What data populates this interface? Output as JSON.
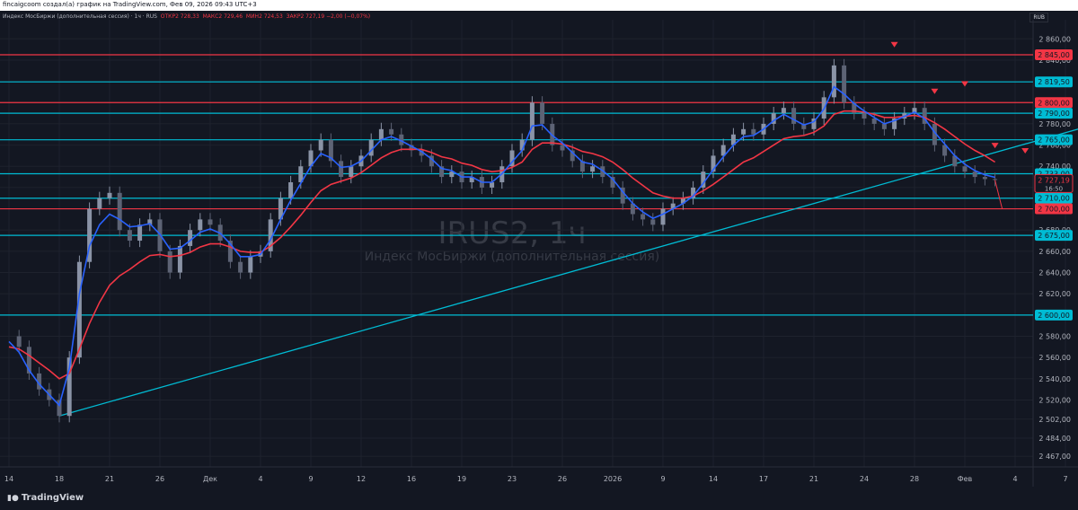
{
  "header": {
    "text": "fincaigcoom создал(а) график на TradingView.com, Фев 09, 2026 09:43 UTC+3",
    "legend": {
      "symbol": "Индекс МосБиржи (дополнительная сессия) · 1ч · RUS",
      "open": "ОТКР2 728,33",
      "high": "МАКС2 729,46",
      "low": "МИН2 724,53",
      "close": "ЗАКР2 727,19 −2,00 (−0,07%)"
    },
    "currency": "RUB"
  },
  "watermark": {
    "title": "IRUS2, 1ч",
    "subtitle": "Индекс МосБиржи (дополнительная сессия)"
  },
  "brand": {
    "name": "TradingView",
    "icon": "tradingview-logo-icon"
  },
  "colors": {
    "background": "#131722",
    "grid": "#1e222d",
    "cyan": "#00bcd4",
    "red_level": "#f23645",
    "ma_blue": "#2962ff",
    "ma_red": "#f23645",
    "candle_up": "#8a93a6",
    "candle_down": "#5d6375",
    "arrow": "#f23645"
  },
  "chart_data": {
    "type": "line",
    "title": "IRUS2, 1ч",
    "xlabel": "",
    "ylabel": "",
    "ylim": [
      2457,
      2878
    ],
    "grid": true,
    "x_ticks": [
      {
        "label": "14",
        "i": 0
      },
      {
        "label": "18",
        "i": 5
      },
      {
        "label": "21",
        "i": 10
      },
      {
        "label": "26",
        "i": 15
      },
      {
        "label": "Дек",
        "i": 20
      },
      {
        "label": "4",
        "i": 25
      },
      {
        "label": "9",
        "i": 30
      },
      {
        "label": "12",
        "i": 35
      },
      {
        "label": "16",
        "i": 40
      },
      {
        "label": "19",
        "i": 45
      },
      {
        "label": "23",
        "i": 50
      },
      {
        "label": "26",
        "i": 55
      },
      {
        "label": "2026",
        "i": 60
      },
      {
        "label": "9",
        "i": 65
      },
      {
        "label": "14",
        "i": 70
      },
      {
        "label": "17",
        "i": 75
      },
      {
        "label": "21",
        "i": 80
      },
      {
        "label": "24",
        "i": 85
      },
      {
        "label": "28",
        "i": 90
      },
      {
        "label": "Фев",
        "i": 95
      },
      {
        "label": "4",
        "i": 100
      },
      {
        "label": "7",
        "i": 105
      }
    ],
    "y_ticks": [
      "2 860,00",
      "2 840,00",
      "2 820,00",
      "2 800,00",
      "2 780,00",
      "2 760,00",
      "2 740,00",
      "2 720,00",
      "2 700,00",
      "2 680,00",
      "2 660,00",
      "2 640,00",
      "2 620,00",
      "2 600,00",
      "2 580,00",
      "2 560,00",
      "2 540,00",
      "2 520,00",
      "2 502,00",
      "2 484,00",
      "2 467,00"
    ],
    "series": [
      {
        "name": "",
        "kind": "close",
        "values": [
          2580,
          2570,
          2545,
          2530,
          2520,
          2505,
          2560,
          2650,
          2700,
          2710,
          2715,
          2680,
          2670,
          2685,
          2690,
          2660,
          2640,
          2665,
          2680,
          2690,
          2685,
          2670,
          2650,
          2640,
          2655,
          2660,
          2690,
          2710,
          2725,
          2740,
          2755,
          2765,
          2745,
          2730,
          2740,
          2750,
          2765,
          2775,
          2770,
          2760,
          2755,
          2750,
          2740,
          2730,
          2735,
          2725,
          2730,
          2720,
          2725,
          2740,
          2755,
          2765,
          2800,
          2780,
          2760,
          2755,
          2745,
          2735,
          2740,
          2730,
          2720,
          2705,
          2695,
          2690,
          2685,
          2700,
          2705,
          2710,
          2720,
          2735,
          2750,
          2760,
          2770,
          2775,
          2770,
          2780,
          2790,
          2795,
          2780,
          2775,
          2785,
          2805,
          2835,
          2800,
          2790,
          2785,
          2780,
          2775,
          2785,
          2790,
          2795,
          2780,
          2760,
          2750,
          2740,
          2735,
          2730,
          2728,
          2727.19
        ]
      },
      {
        "name": "",
        "kind": "ma_fast",
        "values": [
          2575,
          2565,
          2548,
          2535,
          2525,
          2515,
          2550,
          2620,
          2665,
          2685,
          2695,
          2690,
          2683,
          2684,
          2686,
          2676,
          2662,
          2663,
          2670,
          2678,
          2681,
          2677,
          2667,
          2655,
          2655,
          2657,
          2671,
          2690,
          2708,
          2724,
          2740,
          2752,
          2748,
          2739,
          2740,
          2745,
          2755,
          2765,
          2768,
          2764,
          2759,
          2754,
          2747,
          2738,
          2736,
          2730,
          2730,
          2725,
          2725,
          2733,
          2744,
          2755,
          2778,
          2779,
          2769,
          2762,
          2753,
          2744,
          2742,
          2736,
          2728,
          2716,
          2705,
          2697,
          2691,
          2695,
          2700,
          2705,
          2712,
          2724,
          2737,
          2749,
          2760,
          2768,
          2769,
          2775,
          2783,
          2789,
          2784,
          2779,
          2782,
          2794,
          2815,
          2808,
          2799,
          2792,
          2786,
          2780,
          2783,
          2787,
          2791,
          2785,
          2772,
          2761,
          2750,
          2742,
          2736,
          2732,
          2729.6
        ]
      },
      {
        "name": "",
        "kind": "ma_slow",
        "values": [
          2570,
          2568,
          2562,
          2555,
          2548,
          2540,
          2545,
          2568,
          2592,
          2612,
          2628,
          2637,
          2643,
          2650,
          2656,
          2657,
          2655,
          2656,
          2659,
          2664,
          2667,
          2667,
          2664,
          2660,
          2659,
          2659,
          2665,
          2673,
          2683,
          2694,
          2706,
          2717,
          2723,
          2726,
          2729,
          2734,
          2741,
          2748,
          2753,
          2756,
          2756,
          2756,
          2753,
          2749,
          2747,
          2743,
          2741,
          2737,
          2735,
          2736,
          2739,
          2744,
          2756,
          2762,
          2762,
          2761,
          2758,
          2754,
          2752,
          2749,
          2744,
          2737,
          2729,
          2722,
          2715,
          2712,
          2710,
          2710,
          2712,
          2717,
          2723,
          2730,
          2737,
          2744,
          2748,
          2754,
          2760,
          2766,
          2768,
          2769,
          2772,
          2778,
          2789,
          2792,
          2792,
          2791,
          2789,
          2786,
          2786,
          2787,
          2788,
          2786,
          2781,
          2775,
          2768,
          2761,
          2755,
          2750,
          2744
        ]
      }
    ],
    "levels": [
      {
        "value": 2845,
        "label": "2 845,00",
        "color": "red"
      },
      {
        "value": 2819.5,
        "label": "2 819,50",
        "color": "cyan"
      },
      {
        "value": 2800,
        "label": "2 800,00",
        "color": "red"
      },
      {
        "value": 2790,
        "label": "2 790,00",
        "color": "cyan"
      },
      {
        "value": 2765,
        "label": "2 765,00",
        "color": "cyan"
      },
      {
        "value": 2733,
        "label": "2 733,00",
        "color": "cyan"
      },
      {
        "value": 2710,
        "label": "2 710,00",
        "color": "cyan"
      },
      {
        "value": 2700,
        "label": "2 700,00",
        "color": "red"
      },
      {
        "value": 2675,
        "label": "2 675,00",
        "color": "cyan"
      },
      {
        "value": 2600,
        "label": "2 600,00",
        "color": "cyan"
      }
    ],
    "last_price": {
      "value": 2727.19,
      "label": "2 727,19",
      "timer": "16:50"
    },
    "trendline": {
      "from": [
        5,
        2505
      ],
      "to": [
        110,
        2785
      ]
    }
  }
}
